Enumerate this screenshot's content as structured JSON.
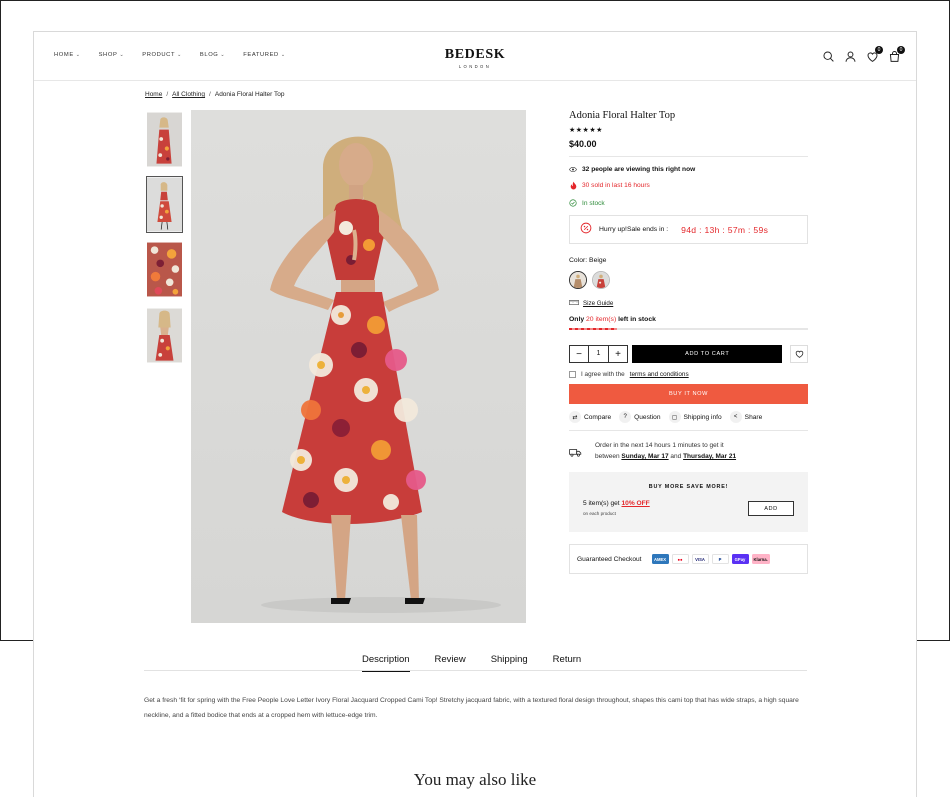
{
  "header": {
    "nav": [
      {
        "label": "HOME"
      },
      {
        "label": "SHOP"
      },
      {
        "label": "PRODUCT"
      },
      {
        "label": "BLOG"
      },
      {
        "label": "FEATURED"
      }
    ],
    "logo_main": "BEDESK",
    "logo_sub": "LONDON",
    "wishlist_count": "0",
    "cart_count": "0"
  },
  "breadcrumb": {
    "home": "Home",
    "category": "All Clothing",
    "current": "Adonia Floral Halter Top",
    "separator": "/"
  },
  "product": {
    "title": "Adonia Floral Halter Top",
    "rating_stars": "★★★★★",
    "price": "$40.00",
    "viewers_count": "32",
    "viewers_text": "people are viewing this right now",
    "sold_text": "30 sold in last 16 hours",
    "stock_status": "In stock",
    "hurry_text": "Hurry up!Sale ends in :",
    "countdown": "94d : 13h : 57m : 59s",
    "color_label": "Color:",
    "color_value": "Beige",
    "size_guide": "Size Guide",
    "stock_prefix": "Only",
    "stock_items": "20 item(s)",
    "stock_suffix": "left in stock",
    "stock_fraction": 0.2,
    "quantity": "1",
    "qty_minus": "−",
    "qty_plus": "+",
    "add_to_cart": "ADD TO CART",
    "agree_text": "I agree with the",
    "terms_link": "terms and conditions",
    "buy_now": "BUY IT NOW",
    "actions": [
      {
        "label": "Compare",
        "icon": "compare-icon"
      },
      {
        "label": "Question",
        "icon": "question-icon"
      },
      {
        "label": "Shipping info",
        "icon": "box-icon"
      },
      {
        "label": "Share",
        "icon": "share-icon"
      }
    ],
    "delivery_line1": "Order in the next 14 hours 1 minutes to get it",
    "delivery_between": "between",
    "delivery_date1": "Sunday, Mar 17",
    "delivery_and": "and",
    "delivery_date2": "Thursday, Mar 21"
  },
  "buy_more": {
    "title": "BUY MORE SAVE MORE!",
    "offer_prefix": "5 item(s) get",
    "offer_pct": "10% OFF",
    "offer_sub": "on each product",
    "add_label": "ADD"
  },
  "checkout": {
    "label": "Guaranteed Checkout",
    "methods": [
      {
        "label": "AMEX",
        "bg": "#2e77bb",
        "fg": "#ffffff"
      },
      {
        "label": "●●",
        "bg": "#ffffff",
        "fg": "#eb001b"
      },
      {
        "label": "VISA",
        "bg": "#ffffff",
        "fg": "#1a1f71"
      },
      {
        "label": "P",
        "bg": "#ffffff",
        "fg": "#003087"
      },
      {
        "label": "GPay",
        "bg": "#5a31f4",
        "fg": "#ffffff"
      },
      {
        "label": "Klarna.",
        "bg": "#ffb3c7",
        "fg": "#111111"
      }
    ]
  },
  "tabs": [
    {
      "label": "Description"
    },
    {
      "label": "Review"
    },
    {
      "label": "Shipping"
    },
    {
      "label": "Return"
    }
  ],
  "description": "Get a fresh ‘fit for spring with the Free People Love Letter Ivory Floral Jacquard Cropped Cami Top! Stretchy jacquard fabric, with a textured floral design throughout, shapes this cami top that has wide straps, a high square neckline, and a fitted bodice that ends at a cropped hem with lettuce-edge trim.",
  "section_title": "You may also like",
  "colors": {
    "accent_red": "#e4272b",
    "buy_now": "#ef5a40",
    "in_stock": "#2e8b3a"
  }
}
